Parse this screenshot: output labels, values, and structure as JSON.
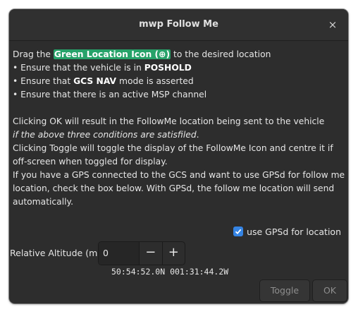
{
  "window": {
    "title": "mwp Follow Me",
    "close_glyph": "×"
  },
  "instructions": {
    "drag_prefix": "Drag the ",
    "drag_highlight": "Green Location Icon (⊕)",
    "drag_suffix": " to the desired location",
    "bullet1_prefix": "• Ensure that the vehicle is in ",
    "bullet1_bold": "POSHOLD",
    "bullet2_prefix": "• Ensure that ",
    "bullet2_bold": "GCS NAV",
    "bullet2_suffix": " mode is asserted",
    "bullet3": "• Ensure that there is an active MSP channel",
    "ok_info": "Clicking OK will result in the FollowMe location being sent to the vehicle",
    "ok_condition": "if the above three conditions are satisfiled",
    "ok_condition_end": ".",
    "toggle_info": "Clicking Toggle will toggle the display of the FollowMe Icon and centre it if off-screen when toggled for display.",
    "gps_info": "If you have a GPS connected to the GCS and want to use GPSd for follow me location, check the box below. With GPSd, the follow me location will send automatically."
  },
  "gpsd": {
    "label": "use GPSd for location",
    "checked": true
  },
  "altitude": {
    "label": "Relative Altitude (m)",
    "value": "0",
    "minus": "−",
    "plus": "+"
  },
  "coordinates": "50:54:52.0N 001:31:44.2W",
  "buttons": {
    "toggle": "Toggle",
    "ok": "OK"
  },
  "colors": {
    "accent": "#3584e4",
    "highlight": "#26a269"
  }
}
